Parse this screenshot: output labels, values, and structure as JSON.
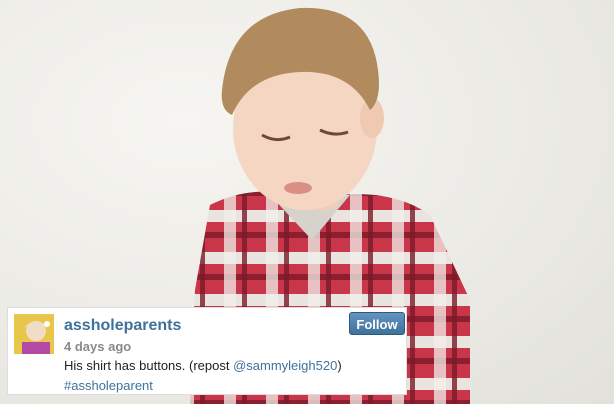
{
  "post": {
    "username": "assholeparents",
    "timestamp": "4 days ago",
    "caption_text": "His shirt has buttons. (repost ",
    "caption_mention": "@sammyleigh520",
    "caption_suffix": ")",
    "hashtag": "#assholeparent",
    "follow_label": "Follow"
  },
  "colors": {
    "link": "#3f729b",
    "follow_button": "#3f729b"
  }
}
